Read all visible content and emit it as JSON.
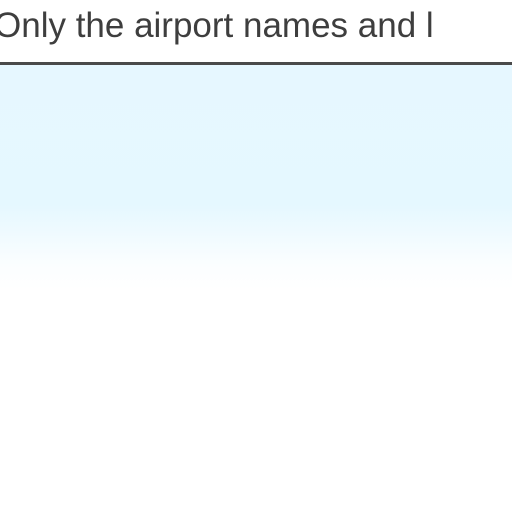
{
  "header": {
    "text": "Only the airport names and l"
  }
}
